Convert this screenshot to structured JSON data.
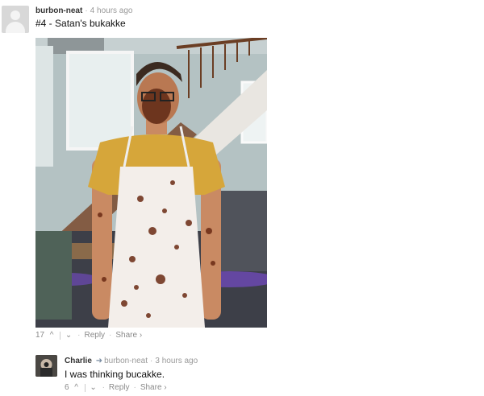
{
  "comment1": {
    "author": "burbon-neat",
    "time": "4 hours ago",
    "text": "#4 - Satan's bukakke",
    "votes": "17",
    "reply_label": "Reply",
    "share_label": "Share ›"
  },
  "comment2": {
    "author": "Charlie",
    "reply_to": "burbon-neat",
    "time": "3 hours ago",
    "text": "I was thinking bucakke.",
    "votes": "6",
    "reply_label": "Reply",
    "share_label": "Share ›"
  },
  "icons": {
    "upvote": "chevron-up-icon",
    "downvote": "chevron-down-icon",
    "reply_arrow": "reply-arrow-icon"
  },
  "colors": {
    "author": "#333333",
    "meta": "#999999",
    "actions": "#8a8a8a"
  }
}
